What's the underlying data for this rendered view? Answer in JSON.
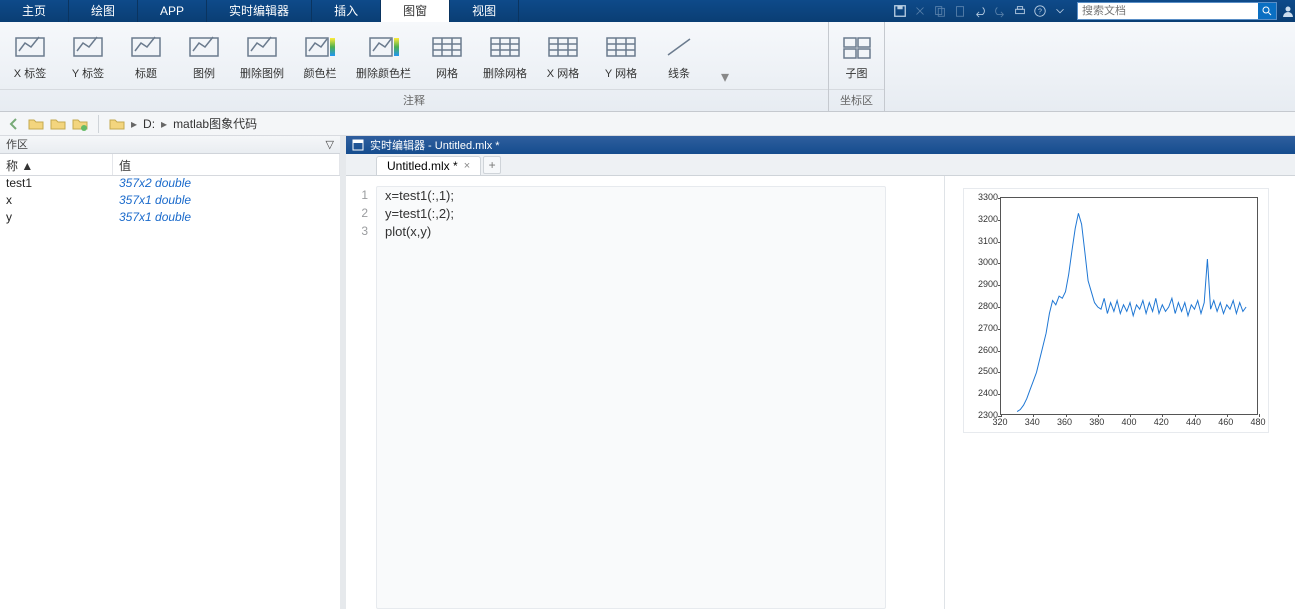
{
  "tabs": [
    "主页",
    "绘图",
    "APP",
    "实时编辑器",
    "插入",
    "图窗",
    "视图"
  ],
  "active_tab": 5,
  "search_placeholder": "搜索文档",
  "ribbon": {
    "group1": {
      "label": "注释",
      "items": [
        "X 标签",
        "Y 标签",
        "标题",
        "图例",
        "删除图例",
        "颜色栏",
        "删除颜色栏",
        "网格",
        "删除网格",
        "X 网格",
        "Y 网格",
        "线条"
      ]
    },
    "group2": {
      "label": "坐标区",
      "item": "子图"
    }
  },
  "path": {
    "drive": "D:",
    "folder": "matlab图象代码"
  },
  "workspace": {
    "title": "作区",
    "columns": [
      "称 ▲",
      "值"
    ],
    "rows": [
      {
        "name": "test1",
        "value": "357x2 double"
      },
      {
        "name": "x",
        "value": "357x1 double"
      },
      {
        "name": "y",
        "value": "357x1 double"
      }
    ]
  },
  "editor": {
    "title": "实时编辑器 - Untitled.mlx *",
    "file_tab": "Untitled.mlx *",
    "lines": [
      "x=test1(:,1);",
      "y=test1(:,2);",
      "plot(x,y)"
    ]
  },
  "chart_data": {
    "type": "line",
    "xlabel": "",
    "ylabel": "",
    "xlim": [
      320,
      480
    ],
    "ylim": [
      2300,
      3300
    ],
    "xticks": [
      320,
      340,
      360,
      380,
      400,
      420,
      440,
      460,
      480
    ],
    "yticks": [
      2300,
      2400,
      2500,
      2600,
      2700,
      2800,
      2900,
      3000,
      3100,
      3200,
      3300
    ],
    "series": [
      {
        "name": "y",
        "color": "#1f77d4",
        "x": [
          330,
          332,
          334,
          336,
          338,
          340,
          342,
          344,
          346,
          348,
          350,
          352,
          354,
          356,
          358,
          360,
          362,
          364,
          366,
          368,
          370,
          372,
          374,
          376,
          378,
          380,
          382,
          384,
          386,
          388,
          390,
          392,
          394,
          396,
          398,
          400,
          402,
          404,
          406,
          408,
          410,
          412,
          414,
          416,
          418,
          420,
          422,
          424,
          426,
          428,
          430,
          432,
          434,
          436,
          438,
          440,
          442,
          444,
          446,
          448,
          450,
          452,
          454,
          456,
          458,
          460,
          462,
          464,
          466,
          468,
          470,
          472
        ],
        "y": [
          2320,
          2330,
          2350,
          2380,
          2420,
          2460,
          2500,
          2560,
          2620,
          2680,
          2770,
          2830,
          2810,
          2850,
          2840,
          2870,
          2950,
          3060,
          3160,
          3230,
          3180,
          3050,
          2920,
          2870,
          2820,
          2800,
          2790,
          2840,
          2770,
          2820,
          2780,
          2830,
          2770,
          2810,
          2780,
          2820,
          2760,
          2810,
          2790,
          2830,
          2770,
          2820,
          2780,
          2840,
          2770,
          2810,
          2780,
          2800,
          2840,
          2770,
          2820,
          2780,
          2820,
          2760,
          2810,
          2790,
          2830,
          2770,
          2820,
          3020,
          2790,
          2830,
          2780,
          2820,
          2770,
          2810,
          2790,
          2830,
          2770,
          2820,
          2780,
          2800
        ]
      }
    ]
  }
}
